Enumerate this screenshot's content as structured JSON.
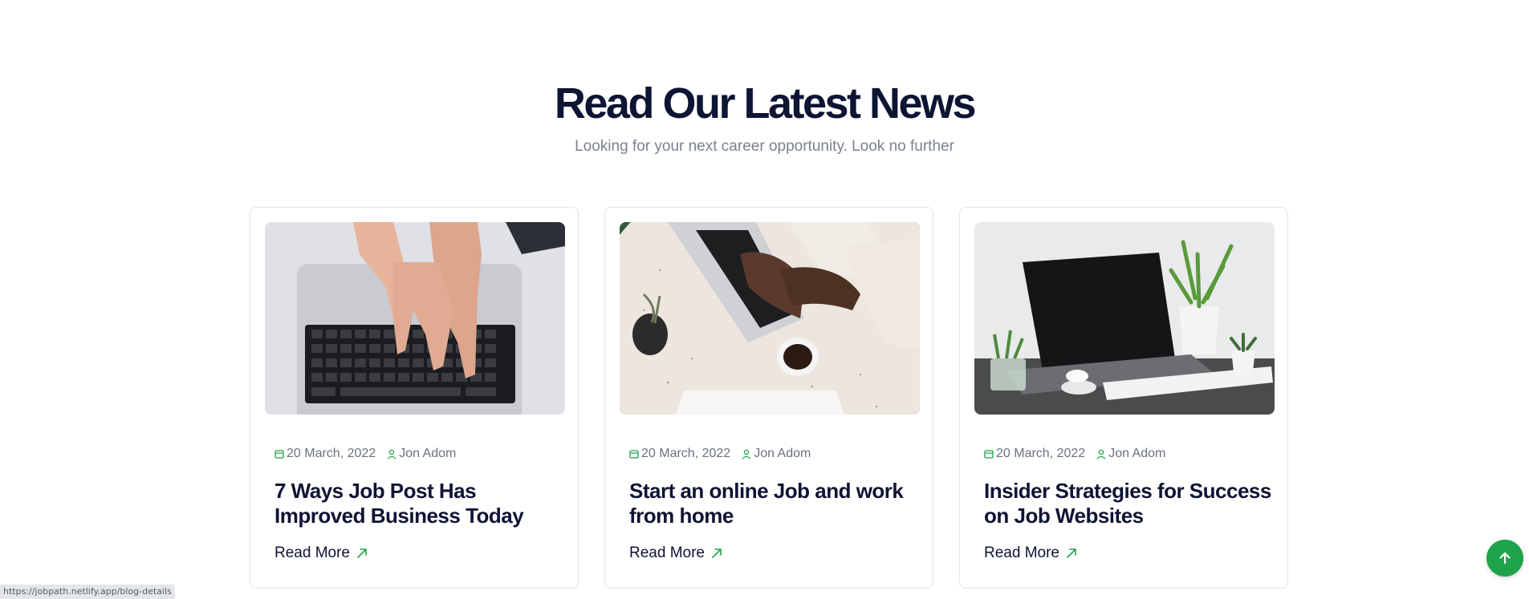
{
  "section": {
    "title": "Read Our Latest News",
    "subtitle": "Looking for your next career opportunity. Look no further"
  },
  "posts": [
    {
      "date": "20 March, 2022",
      "author": "Jon Adom",
      "title": "7 Ways Job Post Has Improved Business Today",
      "read_more": "Read More",
      "image": "hands-typing-laptop-photo"
    },
    {
      "date": "20 March, 2022",
      "author": "Jon Adom",
      "title": "Start an online Job and work from home",
      "read_more": "Read More",
      "image": "laptop-coffee-table-photo"
    },
    {
      "date": "20 March, 2022",
      "author": "Jon Adom",
      "title": "Insider Strategies for Success on Job Websites",
      "read_more": "Read More",
      "image": "desk-laptop-plants-photo"
    }
  ],
  "icons": {
    "date": "calendar-icon",
    "author": "user-icon",
    "read_more": "arrow-up-right-icon",
    "scroll_top": "arrow-up-icon"
  },
  "colors": {
    "accent": "#1fa34a",
    "heading": "#0e1433",
    "muted": "#7b8190",
    "border": "#e3e5ea"
  },
  "status_bar": {
    "url": "https://jobpath.netlify.app/blog-details"
  }
}
